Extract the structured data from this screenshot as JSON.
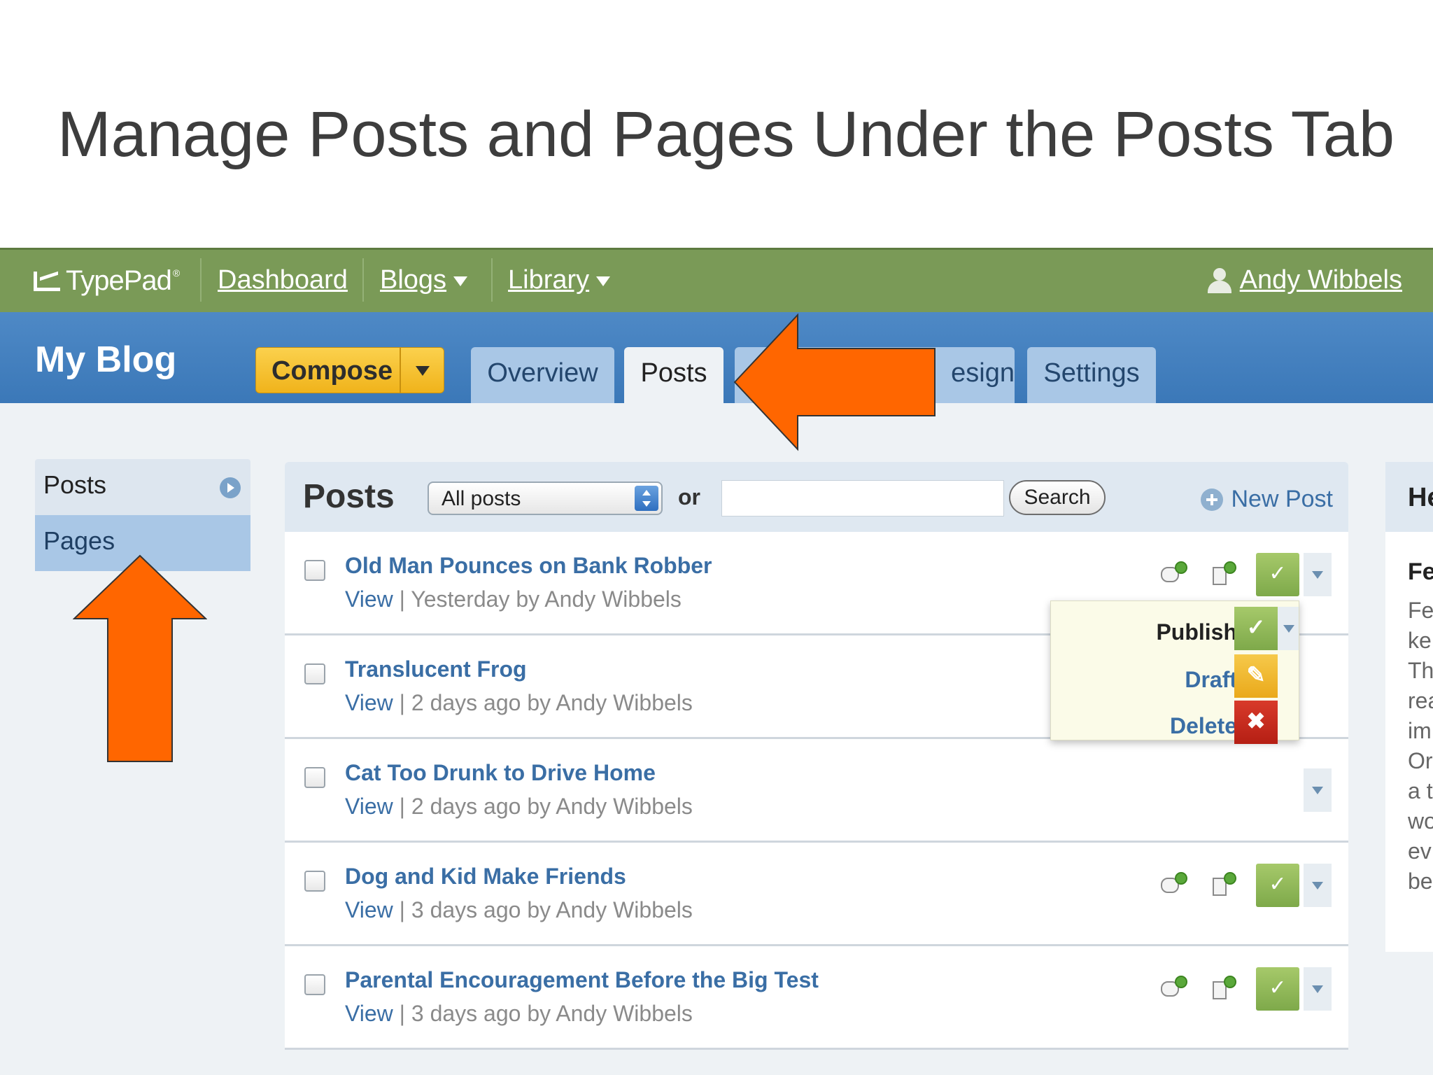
{
  "slide": {
    "title": "Manage Posts and Pages Under the Posts Tab"
  },
  "topbar": {
    "logo": "TypePad",
    "logo_mark": "®",
    "links": [
      "Dashboard",
      "Blogs",
      "Library"
    ],
    "user": "Andy Wibbels"
  },
  "header": {
    "blog_title": "My Blog",
    "compose": "Compose",
    "tabs": [
      "Overview",
      "Posts",
      "Design",
      "Settings"
    ],
    "design_tab_visible": "esign"
  },
  "sidebar": {
    "items": [
      "Posts",
      "Pages"
    ]
  },
  "posts_panel": {
    "title": "Posts",
    "filter_selected": "All posts",
    "or": "or",
    "search_label": "Search",
    "new_post": "New Post",
    "view_label": "View",
    "rows": [
      {
        "title": "Old Man Pounces on Bank Robber",
        "meta": " | Yesterday by Andy Wibbels"
      },
      {
        "title": "Translucent Frog",
        "meta": " | 2 days ago by Andy Wibbels"
      },
      {
        "title": "Cat Too Drunk to Drive Home",
        "meta": " | 2 days ago by Andy Wibbels"
      },
      {
        "title": "Dog and Kid Make Friends",
        "meta": " | 3 days ago by Andy Wibbels"
      },
      {
        "title": "Parental Encouragement Before the Big Test",
        "meta": " | 3 days ago by Andy Wibbels"
      }
    ],
    "status_menu": {
      "publish": "Publish",
      "draft": "Draft",
      "delete": "Delete"
    },
    "check_glyph": "✓",
    "pencil_glyph": "✎",
    "x_glyph": "✖"
  },
  "right_panel": {
    "heading": "He",
    "subheading": "Fe",
    "lines": [
      "Fe",
      "ke",
      "Th",
      "rea",
      "im",
      "Or",
      "a t",
      "wo",
      "ev",
      "be"
    ]
  },
  "colors": {
    "topbar": "#7a9a57",
    "header": "#3b78b8",
    "compose": "#f0b31b",
    "link": "#3a6ea5",
    "arrow": "#ff6600"
  },
  "icons": [
    "chevron-down-icon",
    "user-avatar-icon",
    "play-circle-icon",
    "plus-circle-icon",
    "comment-icon",
    "trackback-icon",
    "check-icon",
    "pencil-icon",
    "delete-icon",
    "select-spinner-icon",
    "arrow-left-annotation",
    "arrow-up-annotation"
  ]
}
